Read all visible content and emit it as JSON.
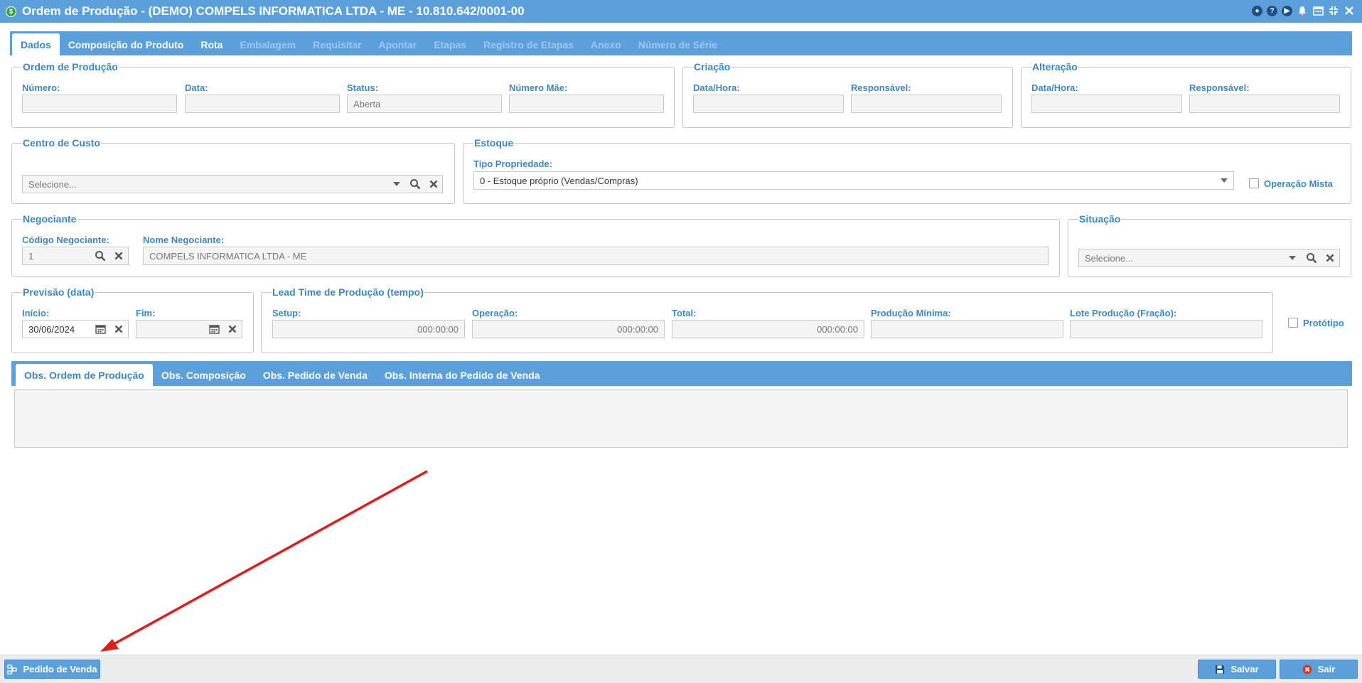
{
  "window": {
    "title": "Ordem de Produção - (DEMO) COMPELS INFORMATICA LTDA - ME - 10.810.642/0001-00",
    "app_icon": "$"
  },
  "main_tabs": [
    {
      "label": "Dados",
      "state": "active"
    },
    {
      "label": "Composição do Produto",
      "state": "enabled"
    },
    {
      "label": "Rota",
      "state": "enabled"
    },
    {
      "label": "Embalagem",
      "state": "disabled"
    },
    {
      "label": "Requisitar",
      "state": "disabled"
    },
    {
      "label": "Apontar",
      "state": "disabled"
    },
    {
      "label": "Etapas",
      "state": "disabled"
    },
    {
      "label": "Registro de Etapas",
      "state": "disabled"
    },
    {
      "label": "Anexo",
      "state": "disabled"
    },
    {
      "label": "Número de Série",
      "state": "disabled"
    }
  ],
  "ordem": {
    "legend": "Ordem de Produção",
    "numero_label": "Número:",
    "numero_value": "",
    "data_label": "Data:",
    "data_value": "",
    "status_label": "Status:",
    "status_value": "Aberta",
    "numero_mae_label": "Número Mãe:",
    "numero_mae_value": ""
  },
  "criacao": {
    "legend": "Criação",
    "datahora_label": "Data/Hora:",
    "datahora_value": "",
    "responsavel_label": "Responsável:",
    "responsavel_value": ""
  },
  "alteracao": {
    "legend": "Alteração",
    "datahora_label": "Data/Hora:",
    "datahora_value": "",
    "responsavel_label": "Responsável:",
    "responsavel_value": ""
  },
  "centro_custo": {
    "legend": "Centro de Custo",
    "placeholder": "Selecione..."
  },
  "estoque": {
    "legend": "Estoque",
    "tipo_label": "Tipo Propriedade:",
    "tipo_value": "0 - Estoque próprio (Vendas/Compras)",
    "operacao_mista_label": "Operação Mista",
    "operacao_mista_checked": false
  },
  "negociante": {
    "legend": "Negociante",
    "codigo_label": "Código Negociante:",
    "codigo_value": "1",
    "nome_label": "Nome Negociante:",
    "nome_value": "COMPELS INFORMATICA LTDA - ME"
  },
  "situacao": {
    "legend": "Situação",
    "placeholder": "Selecione..."
  },
  "previsao": {
    "legend": "Previsão (data)",
    "inicio_label": "Início:",
    "inicio_value": "30/06/2024",
    "fim_label": "Fim:",
    "fim_value": ""
  },
  "lead_time": {
    "legend": "Lead Time de Produção (tempo)",
    "setup_label": "Setup:",
    "setup_value": "000:00:00",
    "operacao_label": "Operação:",
    "operacao_value": "000:00:00",
    "total_label": "Total:",
    "total_value": "000:00:00",
    "producao_minima_label": "Produção Mínima:",
    "producao_minima_value": "",
    "lote_label": "Lote Produção (Fração):",
    "lote_value": ""
  },
  "prototipo": {
    "label": "Protótipo",
    "checked": false
  },
  "obs_tabs": [
    {
      "label": "Obs. Ordem de Produção",
      "state": "active"
    },
    {
      "label": "Obs. Composição",
      "state": "enabled"
    },
    {
      "label": "Obs. Pedido de Venda",
      "state": "enabled"
    },
    {
      "label": "Obs. Interna do Pedido de Venda",
      "state": "enabled"
    }
  ],
  "footer": {
    "pedido_venda_label": "Pedido de Venda",
    "salvar_label": "Salvar",
    "sair_label": "Sair"
  },
  "colors": {
    "accent": "#5b9fdb",
    "label_blue": "#3a87c9",
    "arrow_red": "#e31b1b"
  }
}
